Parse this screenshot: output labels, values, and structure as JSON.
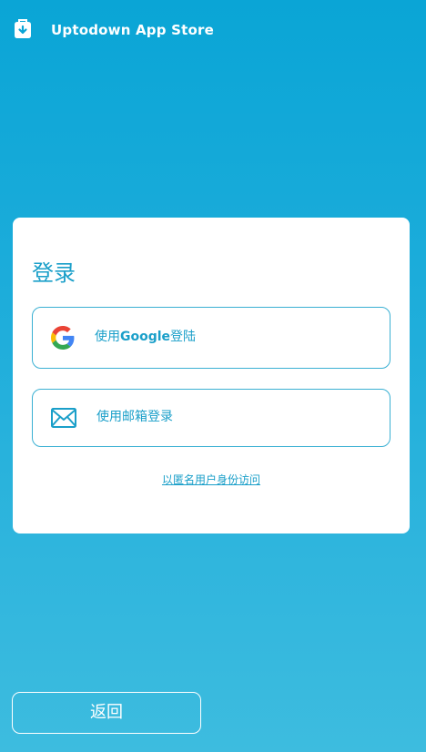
{
  "header": {
    "title": "Uptodown App Store",
    "logo_icon": "uptodown-logo-icon"
  },
  "login": {
    "title": "登录",
    "google": {
      "label_prefix": "使用",
      "label_brand": "Google",
      "label_suffix": "登陆",
      "icon": "google-g-icon"
    },
    "email": {
      "label": "使用邮箱登录",
      "icon": "envelope-icon"
    },
    "anonymous_link": "以匿名用户身份访问"
  },
  "footer": {
    "back_label": "返回"
  },
  "colors": {
    "accent": "#1a9fc9",
    "background_top": "#0aa5d6",
    "background_bottom": "#3dbcdf",
    "card": "#ffffff"
  }
}
